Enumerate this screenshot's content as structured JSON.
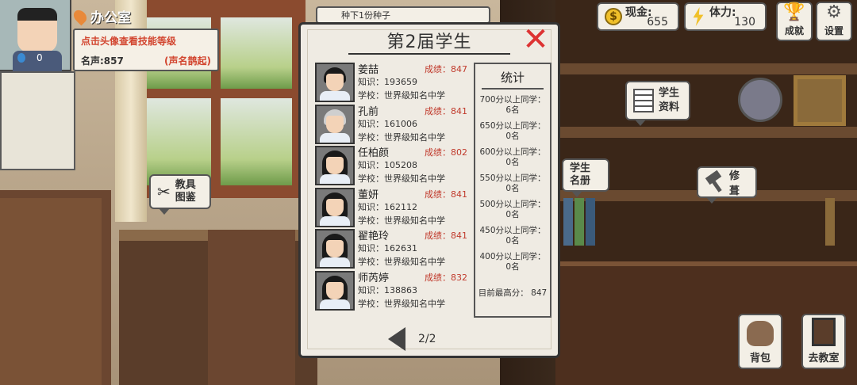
{
  "hud": {
    "avatar_level": "0",
    "location": "办公室",
    "info_hint": "点击头像查看技能等级",
    "reputation_label": "名声:857",
    "reputation_title": "(声名鹊起)",
    "task_strip": "种下1份种子",
    "cash_label": "现金:",
    "cash_value": "655",
    "stamina_label": "体力:",
    "stamina_value": "130",
    "achievements_label": "成就",
    "settings_label": "设置"
  },
  "bubbles": {
    "staff_directory_l1": "教具",
    "staff_directory_l2": "图鉴",
    "student_info_l1": "学生",
    "student_info_l2": "资料",
    "student_roster_l1": "学生",
    "student_roster_l2": "名册",
    "renovate": "修葺"
  },
  "bottom": {
    "backpack_label": "背包",
    "classroom_label": "去教室"
  },
  "modal": {
    "title": "第2届学生",
    "close_glyph": "✕",
    "page": "2/2",
    "students": [
      {
        "name": "姜喆",
        "score": "成绩：847",
        "knowledge": "知识：193659",
        "school": "学校：世界级知名中学",
        "portrait": "boy"
      },
      {
        "name": "孔前",
        "score": "成绩：841",
        "knowledge": "知识：161006",
        "school": "学校：世界级知名中学",
        "portrait": "bald"
      },
      {
        "name": "任柏颜",
        "score": "成绩：802",
        "knowledge": "知识：105208",
        "school": "学校：世界级知名中学",
        "portrait": "long"
      },
      {
        "name": "董妍",
        "score": "成绩：841",
        "knowledge": "知识：162112",
        "school": "学校：世界级知名中学",
        "portrait": "long"
      },
      {
        "name": "翟艳玲",
        "score": "成绩：841",
        "knowledge": "知识：162631",
        "school": "学校：世界级知名中学",
        "portrait": "long"
      },
      {
        "name": "师芮婷",
        "score": "成绩：832",
        "knowledge": "知识：138863",
        "school": "学校：世界级知名中学",
        "portrait": "long"
      }
    ],
    "stats": {
      "title": "统计",
      "rows": [
        {
          "label": "700分以上同学：",
          "count": "6名"
        },
        {
          "label": "650分以上同学：",
          "count": "0名"
        },
        {
          "label": "600分以上同学：",
          "count": "0名"
        },
        {
          "label": "550分以上同学：",
          "count": "0名"
        },
        {
          "label": "500分以上同学：",
          "count": "0名"
        },
        {
          "label": "450分以上同学：",
          "count": "0名"
        },
        {
          "label": "400分以上同学：",
          "count": "0名"
        }
      ],
      "max_score": "目前最高分：  847"
    }
  },
  "colors": {
    "accent_red": "#d2452f",
    "score_red": "#c0392b",
    "panel_bg": "#efebe3",
    "coin": "#f0c02a"
  }
}
